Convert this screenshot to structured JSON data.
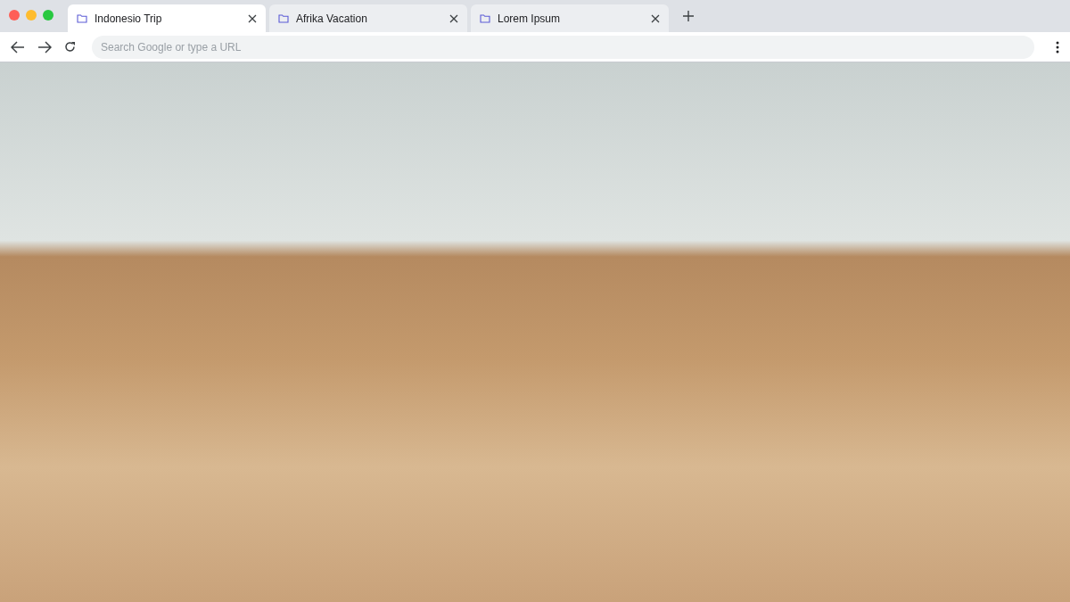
{
  "tabs": [
    {
      "label": "Indonesio Trip",
      "selected": true
    },
    {
      "label": "Afrika Vacation",
      "selected": false
    },
    {
      "label": "Lorem Ipsum",
      "selected": false
    }
  ],
  "address_bar": {
    "placeholder": "Search Google or type a URL"
  }
}
